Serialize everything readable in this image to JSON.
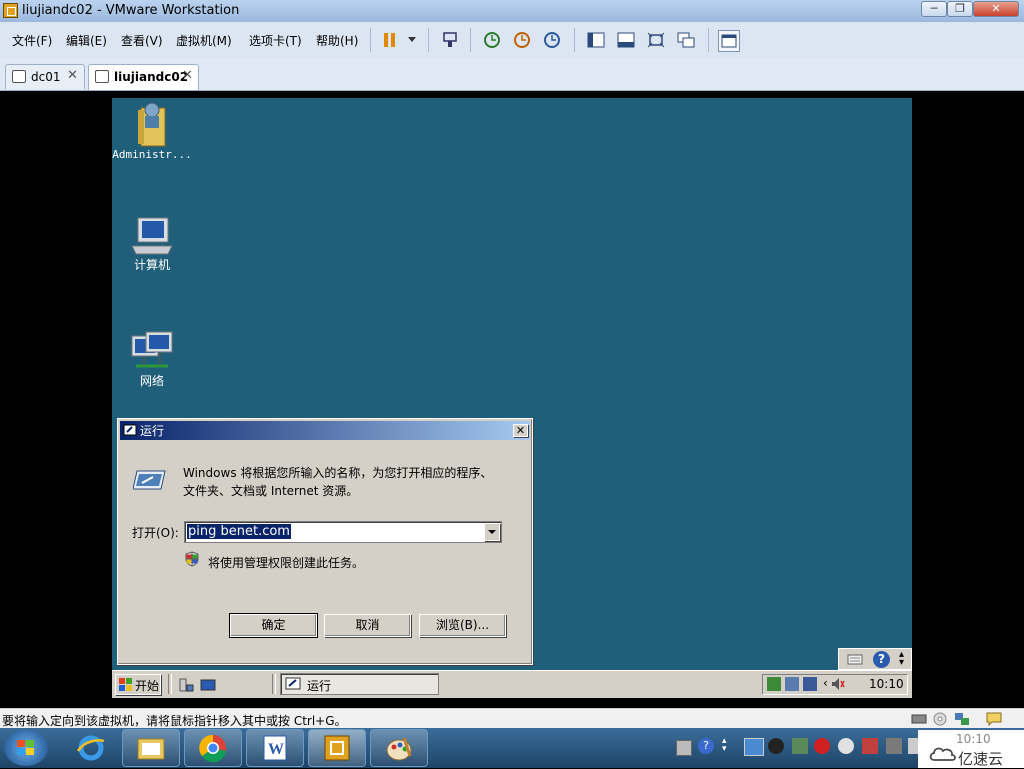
{
  "window": {
    "title": "liujiandc02 - VMware Workstation"
  },
  "menu": [
    "文件(F)",
    "编辑(E)",
    "查看(V)",
    "虚拟机(M)",
    "选项卡(T)",
    "帮助(H)"
  ],
  "tabs": [
    {
      "label": "dc01",
      "active": false
    },
    {
      "label": "liujiandc02",
      "active": true
    }
  ],
  "desktop": {
    "icons": [
      {
        "label": "Administr...",
        "icon": "user-folder-icon"
      },
      {
        "label": "计算机",
        "icon": "computer-icon"
      },
      {
        "label": "网络",
        "icon": "network-icon"
      }
    ]
  },
  "run_dialog": {
    "title": "运行",
    "description_line1": "Windows 将根据您所输入的名称，为您打开相应的程序、",
    "description_line2": "文件夹、文档或 Internet 资源。",
    "open_label": "打开(O):",
    "open_value": "ping benet.com",
    "admin_note": "将使用管理权限创建此任务。",
    "ok": "确定",
    "cancel": "取消",
    "browse": "浏览(B)..."
  },
  "guest_taskbar": {
    "start": "开始",
    "task": "运行",
    "clock": "10:10"
  },
  "status": {
    "text": "要将输入定向到该虚拟机，请将鼠标指针移入其中或按 Ctrl+G。"
  },
  "host_taskbar": {
    "clock": "10:10",
    "watermark": "亿速云"
  },
  "colors": {
    "desktop": "#1f5f79",
    "dialog_title": "#0a246a"
  }
}
